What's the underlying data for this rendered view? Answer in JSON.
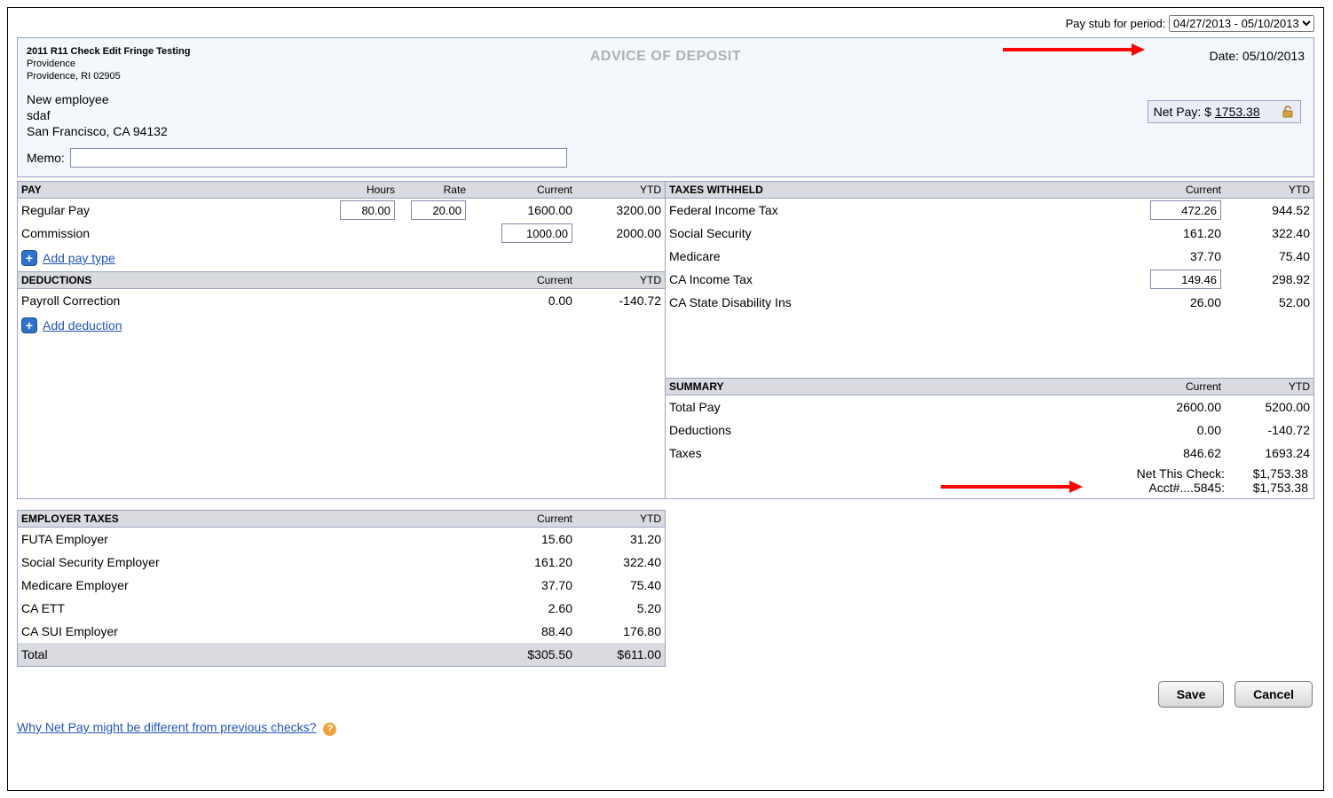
{
  "period": {
    "label": "Pay stub for period:",
    "selected": "04/27/2013 - 05/10/2013"
  },
  "header": {
    "company_line1": "2011 R11 Check Edit Fringe Testing",
    "company_line2": "Providence",
    "company_line3": "Providence, RI 02905",
    "advice_title": "ADVICE OF DEPOSIT",
    "date_label": "Date:",
    "date_value": "05/10/2013",
    "employee_line1": "New employee",
    "employee_line2": "sdaf",
    "employee_line3": "San Francisco, CA 94132",
    "netpay_label": "Net Pay: $",
    "netpay_value": "1753.38",
    "memo_label": "Memo:",
    "memo_value": ""
  },
  "pay": {
    "heading": "PAY",
    "col_hours": "Hours",
    "col_rate": "Rate",
    "col_current": "Current",
    "col_ytd": "YTD",
    "rows": [
      {
        "label": "Regular Pay",
        "hours": "80.00",
        "rate": "20.00",
        "current": "1600.00",
        "ytd": "3200.00",
        "hours_editable": true,
        "rate_editable": true
      },
      {
        "label": "Commission",
        "hours": "",
        "rate": "",
        "current": "1000.00",
        "ytd": "2000.00",
        "current_editable": true
      }
    ],
    "add_label": "Add pay type"
  },
  "deductions": {
    "heading": "DEDUCTIONS",
    "col_current": "Current",
    "col_ytd": "YTD",
    "rows": [
      {
        "label": "Payroll Correction",
        "current": "0.00",
        "ytd": "-140.72"
      }
    ],
    "add_label": "Add deduction"
  },
  "taxes": {
    "heading": "TAXES WITHHELD",
    "col_current": "Current",
    "col_ytd": "YTD",
    "rows": [
      {
        "label": "Federal Income Tax",
        "current": "472.26",
        "ytd": "944.52",
        "current_editable": true
      },
      {
        "label": "Social Security",
        "current": "161.20",
        "ytd": "322.40"
      },
      {
        "label": "Medicare",
        "current": "37.70",
        "ytd": "75.40"
      },
      {
        "label": "CA Income Tax",
        "current": "149.46",
        "ytd": "298.92",
        "current_editable": true
      },
      {
        "label": "CA State Disability Ins",
        "current": "26.00",
        "ytd": "52.00"
      }
    ]
  },
  "summary": {
    "heading": "SUMMARY",
    "col_current": "Current",
    "col_ytd": "YTD",
    "rows": [
      {
        "label": "Total Pay",
        "current": "2600.00",
        "ytd": "5200.00"
      },
      {
        "label": "Deductions",
        "current": "0.00",
        "ytd": "-140.72"
      },
      {
        "label": "Taxes",
        "current": "846.62",
        "ytd": "1693.24"
      }
    ],
    "net_this_check_label": "Net This Check:",
    "net_this_check_value": "$1,753.38",
    "acct_label": "Acct#....5845:",
    "acct_value": "$1,753.38"
  },
  "employer_taxes": {
    "heading": "EMPLOYER TAXES",
    "col_current": "Current",
    "col_ytd": "YTD",
    "rows": [
      {
        "label": "FUTA Employer",
        "current": "15.60",
        "ytd": "31.20"
      },
      {
        "label": "Social Security Employer",
        "current": "161.20",
        "ytd": "322.40"
      },
      {
        "label": "Medicare Employer",
        "current": "37.70",
        "ytd": "75.40"
      },
      {
        "label": "CA ETT",
        "current": "2.60",
        "ytd": "5.20"
      },
      {
        "label": "CA SUI Employer",
        "current": "88.40",
        "ytd": "176.80"
      }
    ],
    "total_label": "Total",
    "total_current": "$305.50",
    "total_ytd": "$611.00"
  },
  "buttons": {
    "save": "Save",
    "cancel": "Cancel"
  },
  "footer": {
    "link": "Why Net Pay might be different from previous checks?"
  }
}
